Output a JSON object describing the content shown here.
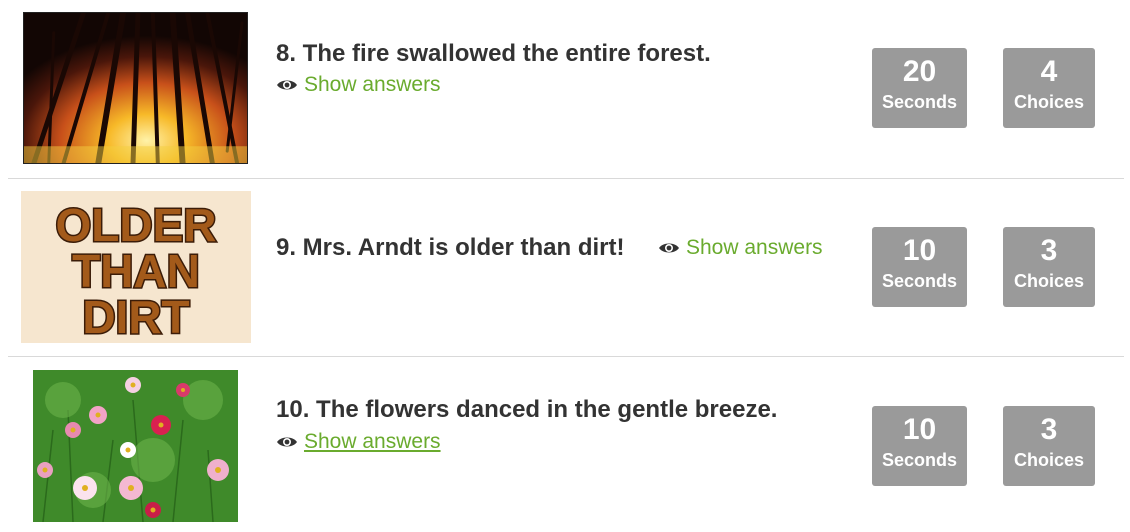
{
  "questions": [
    {
      "text": "8. The fire swallowed the entire forest.",
      "show_answers": "Show answers",
      "seconds": "20",
      "seconds_label": "Seconds",
      "choices": "4",
      "choices_label": "Choices"
    },
    {
      "text": "9. Mrs. Arndt is older than dirt!",
      "show_answers": "Show answers",
      "seconds": "10",
      "seconds_label": "Seconds",
      "choices": "3",
      "choices_label": "Choices",
      "image_text": [
        "OLDER",
        "THAN",
        "DIRT"
      ]
    },
    {
      "text": "10. The flowers danced in the gentle breeze.",
      "show_answers": "Show answers",
      "seconds": "10",
      "seconds_label": "Seconds",
      "choices": "3",
      "choices_label": "Choices"
    }
  ],
  "colors": {
    "link_green": "#6aab2e",
    "stat_box_gray": "#9a9a9a",
    "question_text": "#333333"
  },
  "icons": {
    "show_answers": "eye-icon"
  }
}
